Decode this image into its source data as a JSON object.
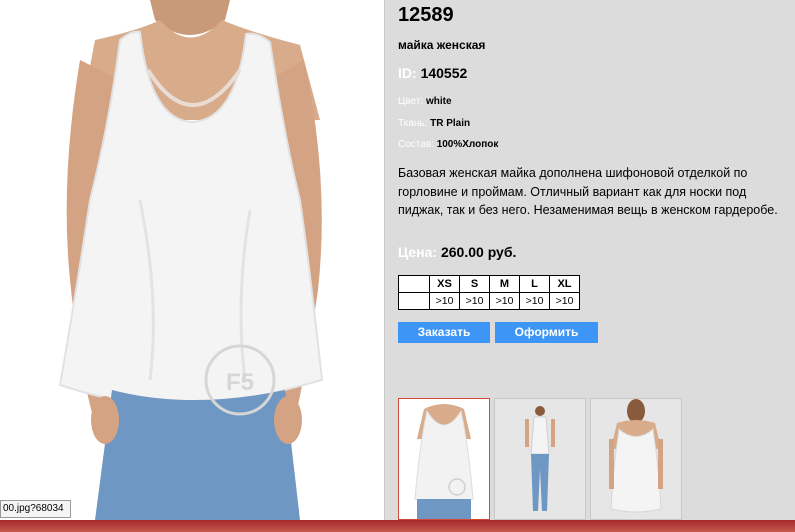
{
  "product": {
    "sku": "12589",
    "name": "майка женская",
    "id_label": "ID:",
    "id_value": "140552",
    "color_label": "Цвет:",
    "color_value": "white",
    "fabric_label": "Ткань:",
    "fabric_value": "TR Plain",
    "composition_label": "Состав:",
    "composition_value": "100%Хлопок",
    "description": "Базовая женская майка дополнена шифоновой отделкой по горловине и проймам. Отличный вариант как для носки под пиджак, так и без него. Незаменимая вещь в женском гардеробе.",
    "price_label": "Цена:",
    "price_value": "260.00 руб."
  },
  "sizes": {
    "headers": [
      "XS",
      "S",
      "M",
      "L",
      "XL"
    ],
    "stock": [
      ">10",
      ">10",
      ">10",
      ">10",
      ">10"
    ]
  },
  "buttons": {
    "order": "Заказать",
    "checkout": "Оформить"
  },
  "status_url": "00.jpg?68034",
  "colors": {
    "accent_button": "#3d95f5",
    "selected_thumb_border": "#d44a3a",
    "panel_bg": "#dcdcdc"
  },
  "thumbnails": [
    {
      "name": "front-closeup",
      "selected": true
    },
    {
      "name": "full-body-front",
      "selected": false
    },
    {
      "name": "back-view",
      "selected": false
    }
  ]
}
